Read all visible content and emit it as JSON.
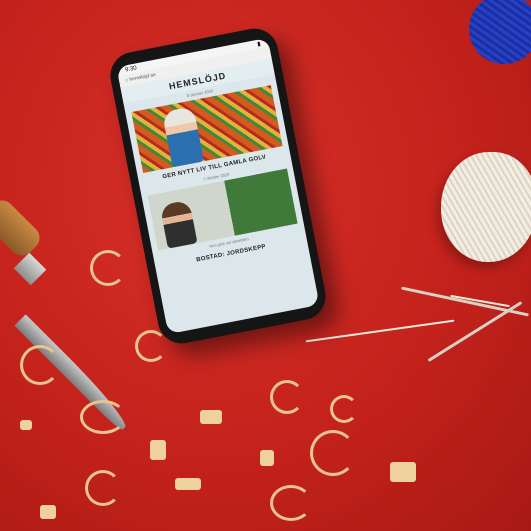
{
  "phone": {
    "status_time": "9:30",
    "url": "hemslojd.se",
    "logo": "HEMSLÖJD",
    "article1": {
      "date": "8 oktober 2020",
      "title": "GER NYTT LIV TILL GAMLA GOLV"
    },
    "article2": {
      "date": "7 oktober 2020",
      "subtitle": "Hon gick vid vävstolen",
      "title": "BOSTAD: JORDSKEPP"
    }
  },
  "colors": {
    "background": "#c8231e",
    "screen": "#dbe7ea"
  }
}
